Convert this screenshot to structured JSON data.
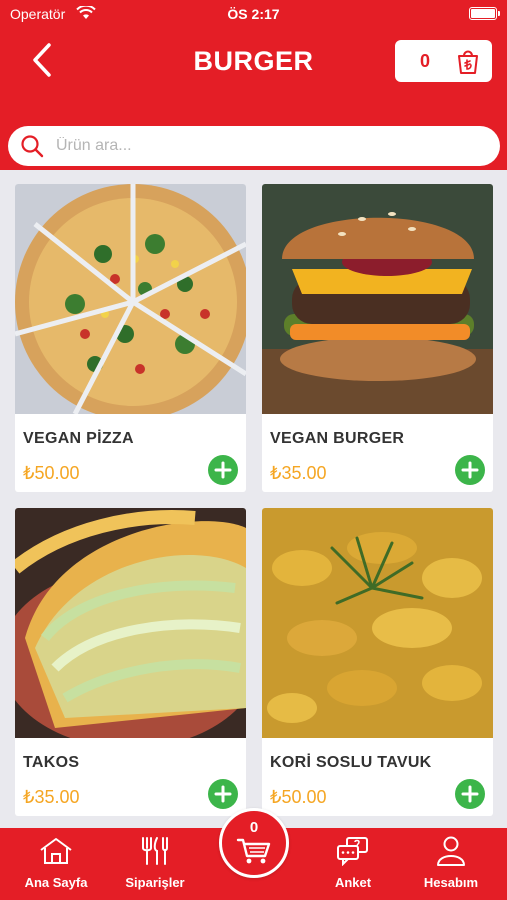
{
  "status_bar": {
    "carrier": "Operatör",
    "time": "ÖS 2:17",
    "battery_level": 1.0
  },
  "header": {
    "title": "BURGER",
    "cart_count": "0",
    "back_icon": "chevron-left-icon",
    "cart_icon": "lira-bag-icon"
  },
  "search": {
    "placeholder": "Ürün ara..."
  },
  "products": [
    {
      "name": "VEGAN PİZZA",
      "price": "₺50.00",
      "image": "vegan-pizza-photo"
    },
    {
      "name": "VEGAN BURGER",
      "price": "₺35.00",
      "image": "vegan-burger-photo"
    },
    {
      "name": "TAKOS",
      "price": "₺35.00",
      "image": "tacos-photo"
    },
    {
      "name": "KORİ SOSLU TAVUK",
      "price": "₺50.00",
      "image": "curry-chicken-photo"
    }
  ],
  "tabbar": {
    "home": "Ana Sayfa",
    "orders": "Siparişler",
    "cart_count": "0",
    "survey": "Anket",
    "account": "Hesabım"
  },
  "colors": {
    "brand_red": "#e41e26",
    "price_orange": "#f5a623",
    "add_green": "#3cb54a"
  }
}
